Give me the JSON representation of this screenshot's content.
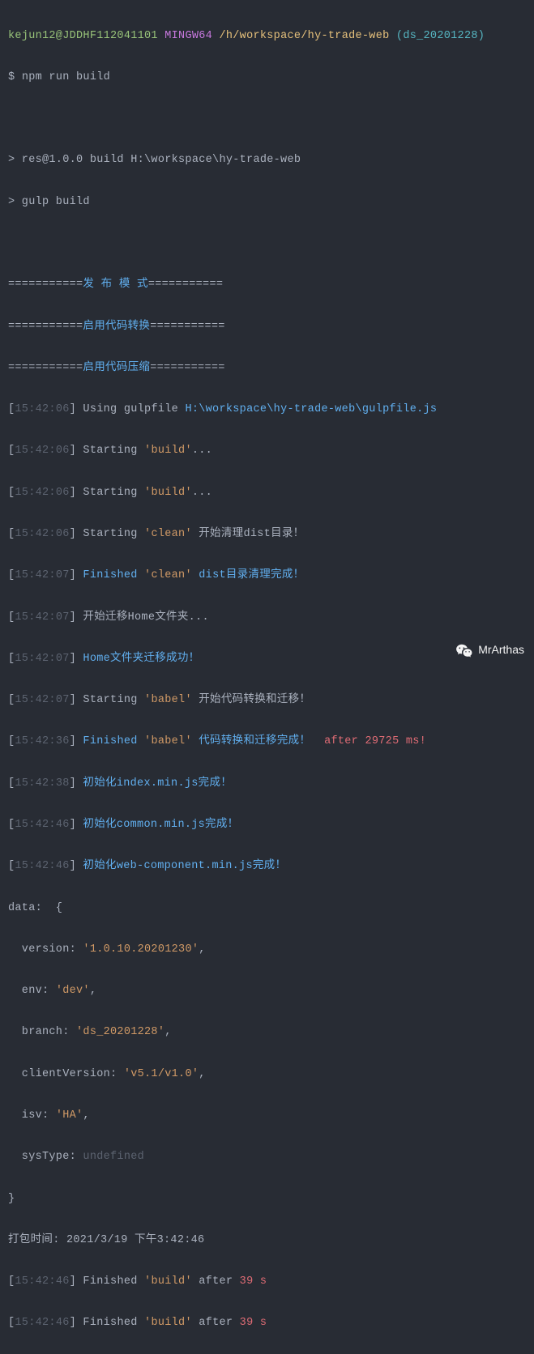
{
  "prompt": {
    "user": "kejun12@JDDHF112041101",
    "env": "MINGW64",
    "path": "/h/workspace/hy-trade-web",
    "branchOpen": "(",
    "branch": "ds_20201228",
    "branchClose": ")",
    "sign": "$ ",
    "command": "npm run build"
  },
  "header1": "> res@1.0.0 build H:\\workspace\\hy-trade-web",
  "header2": "> gulp build",
  "banner1a": "===========",
  "banner1b": "发 布 模 式",
  "banner1c": "===========",
  "banner2a": "===========",
  "banner2b": "启用代码转换",
  "banner2c": "===========",
  "banner3a": "===========",
  "banner3b": "启用代码压缩",
  "banner3c": "===========",
  "log": {
    "t1": "15:42:06",
    "t2": "15:42:07",
    "t3": "15:42:36",
    "t4": "15:42:38",
    "t5": "15:42:46",
    "usingGulpfile": " Using gulpfile ",
    "gulpfilePath": "H:\\workspace\\hy-trade-web\\gulpfile.js",
    "starting": " Starting ",
    "finished": " Finished ",
    "build": "'build'",
    "dots": "...",
    "clean": "'clean'",
    "cleanStart": " 开始清理dist目录！",
    "cleanDone": " dist目录清理完成！",
    "migrateStart": " 开始迁移Home文件夹...",
    "migrateDone": " Home文件夹迁移成功！",
    "babel": "'babel'",
    "babelStart": " 开始代码转换和迁移！",
    "babelDone": " 代码转换和迁移完成！",
    "afterBabel": "  after 29725 ms!",
    "initIndex": " 初始化index.min.js完成！",
    "initCommon": " 初始化common.min.js完成！",
    "initWeb": " 初始化web-component.min.js完成！",
    "after": " after ",
    "duration": "39 s"
  },
  "data": {
    "header": "data:  {",
    "versionKey": "  version: ",
    "versionVal": "'1.0.10.20201230'",
    "envKey": "  env: ",
    "envVal": "'dev'",
    "branchKey": "  branch: ",
    "branchVal": "'ds_20201228'",
    "clientKey": "  clientVersion: ",
    "clientVal": "'v5.1/v1.0'",
    "isvKey": "  isv: ",
    "isvVal": "'HA'",
    "sysKey": "  sysType: ",
    "sysVal": "undefined",
    "close": "}",
    "comma": ","
  },
  "packTime": "打包时间: 2021/3/19 下午3:42:46",
  "watermark": "MrArthas"
}
